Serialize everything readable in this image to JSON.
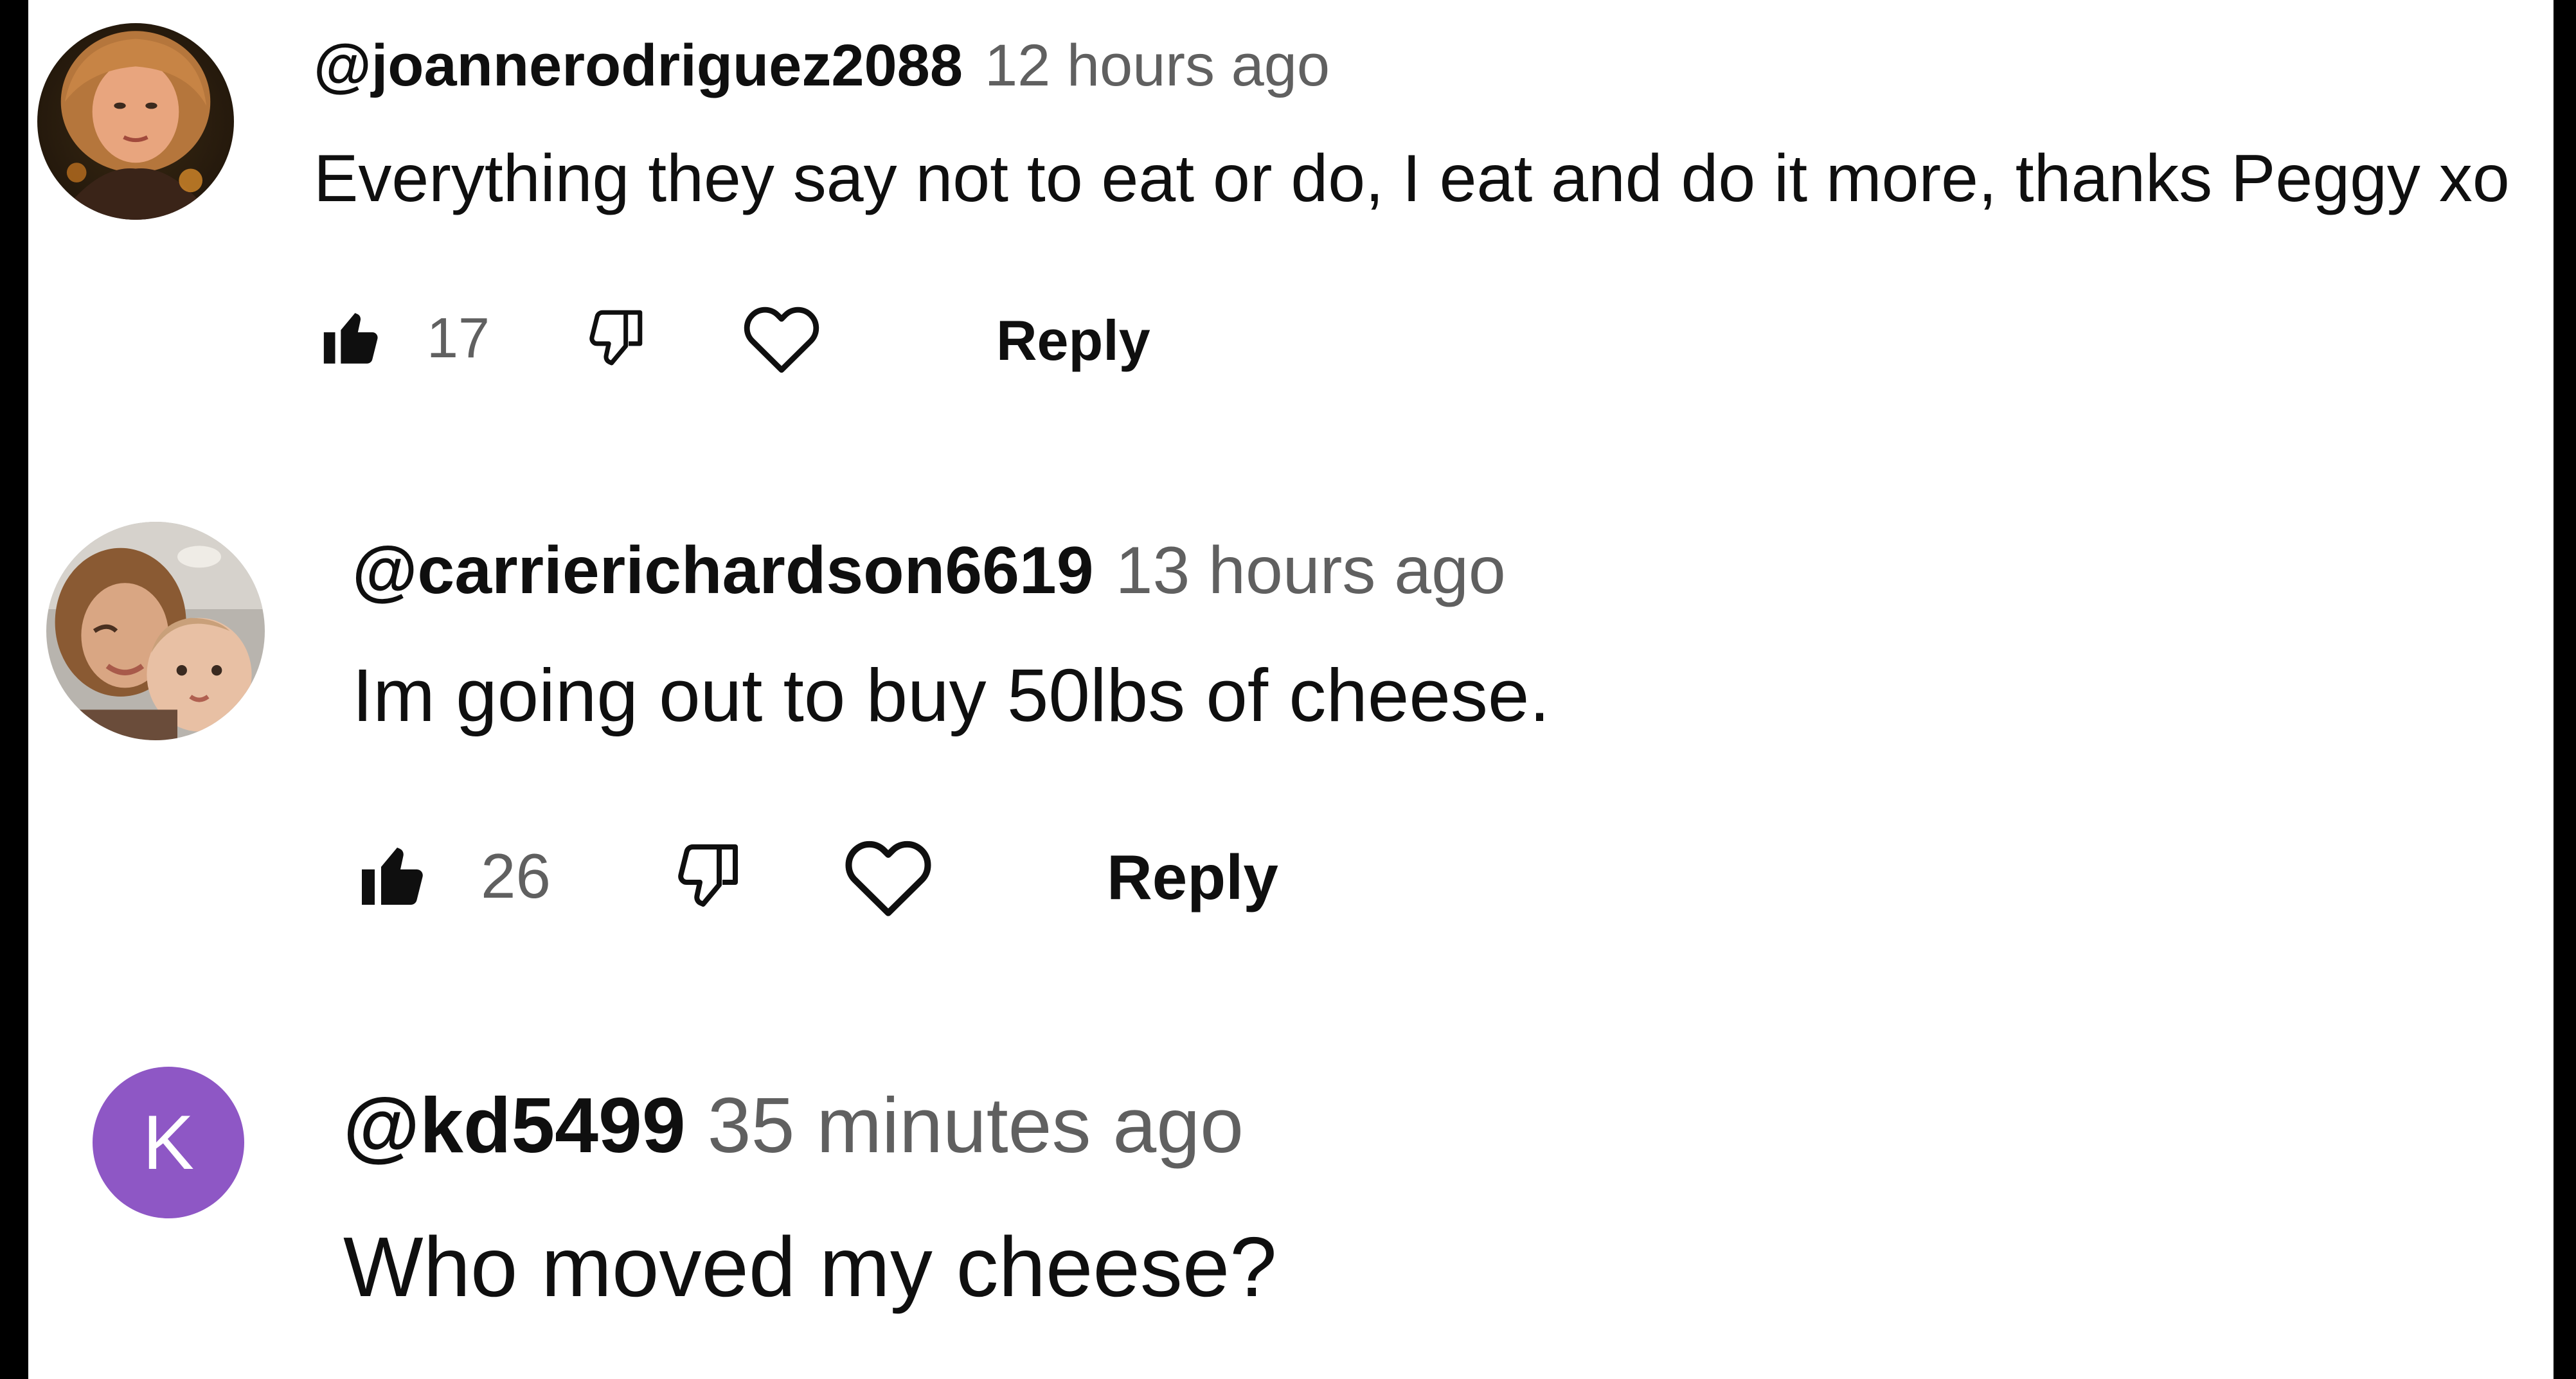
{
  "colors": {
    "background_frame": "#000000",
    "panel": "#ffffff",
    "text_primary": "#0f0f0f",
    "text_secondary": "#606060",
    "letter_avatar": "#8e57c5"
  },
  "comments": [
    {
      "handle": "@joannerodriguez2088",
      "time": "12 hours ago",
      "text": "Everything they say not to eat or do, I eat and do it more, thanks Peggy xo",
      "likes": "17",
      "reply_label": "Reply",
      "avatar": "photo-avatar"
    },
    {
      "handle": "@carrierichardson6619",
      "time": "13 hours ago",
      "text": "Im going out to buy 50lbs of cheese.",
      "likes": "26",
      "reply_label": "Reply",
      "avatar": "photo-avatar"
    },
    {
      "handle": "@kd5499",
      "time": "35 minutes ago",
      "text": "Who moved my cheese?",
      "avatar": "letter-avatar",
      "avatar_letter": "K"
    }
  ],
  "icons": {
    "like": "thumbs-up-icon",
    "dislike": "thumbs-down-icon",
    "heart": "heart-icon"
  }
}
